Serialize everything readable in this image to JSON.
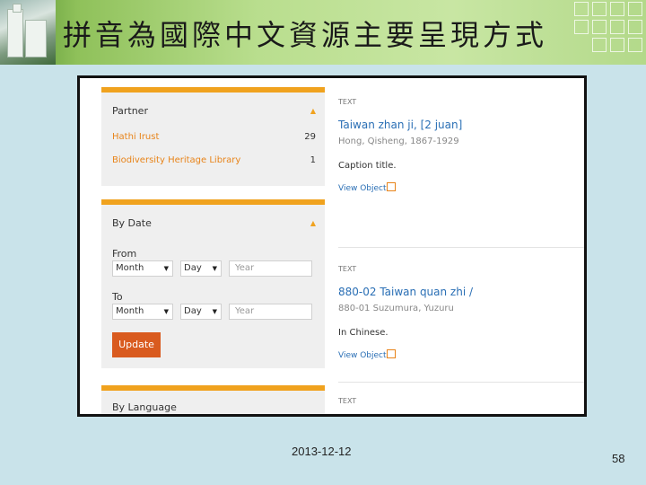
{
  "slide": {
    "title": "拼音為國際中文資源主要呈現方式",
    "date": "2013-12-12",
    "page_number": "58"
  },
  "filters": {
    "partner": {
      "heading": "Partner",
      "items": [
        {
          "label": "Hathi Irust",
          "count": "29"
        },
        {
          "label": "Biodiversity Heritage Library",
          "count": "1"
        }
      ]
    },
    "by_date": {
      "heading": "By Date",
      "from_label": "From",
      "to_label": "To",
      "month": "Month",
      "day": "Day",
      "year_placeholder": "Year",
      "update_label": "Update"
    },
    "by_language": {
      "heading": "By Language"
    }
  },
  "results": [
    {
      "type": "TEXT",
      "title": "Taiwan zhan ji, [2 juan]",
      "author": "Hong, Qisheng, 1867-1929",
      "description": "Caption title.",
      "link": "View Object"
    },
    {
      "type": "TEXT",
      "title": "880-02 Taiwan quan zhi /",
      "author": "880-01 Suzumura, Yuzuru",
      "description": "In Chinese.",
      "link": "View Object"
    },
    {
      "type": "TEXT"
    }
  ],
  "colors": {
    "accent": "#f0a21e",
    "link": "#2a6fb5",
    "partner_link": "#e8841a",
    "button": "#d95b1f"
  }
}
